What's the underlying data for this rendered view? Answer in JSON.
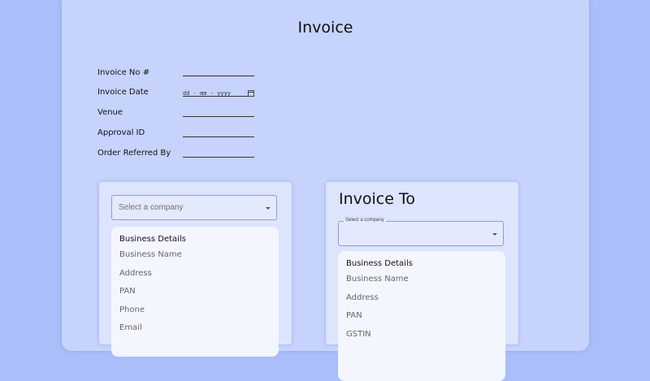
{
  "page": {
    "title": "Invoice"
  },
  "fields": {
    "invoice_no_label": "Invoice No #",
    "invoice_date_label": "Invoice Date",
    "invoice_date_placeholder": "dd - mm - yyyy",
    "venue_label": "Venue",
    "approval_id_label": "Approval ID",
    "order_referred_by_label": "Order Referred By"
  },
  "from_panel": {
    "select_placeholder": "Select a company",
    "details_title": "Business Details",
    "items": [
      "Business Name",
      "Address",
      "PAN",
      "Phone",
      "Email"
    ]
  },
  "to_panel": {
    "title": "Invoice To",
    "select_label": "Select a company",
    "details_title": "Business Details",
    "items": [
      "Business Name",
      "Address",
      "PAN",
      "GSTIN"
    ]
  },
  "icons": {
    "date": "calendar-icon",
    "dropdown": "chevron-down-icon"
  },
  "colors": {
    "background": "#aabefa",
    "card": "#c6d3fd",
    "panel": "#dce4fe"
  }
}
